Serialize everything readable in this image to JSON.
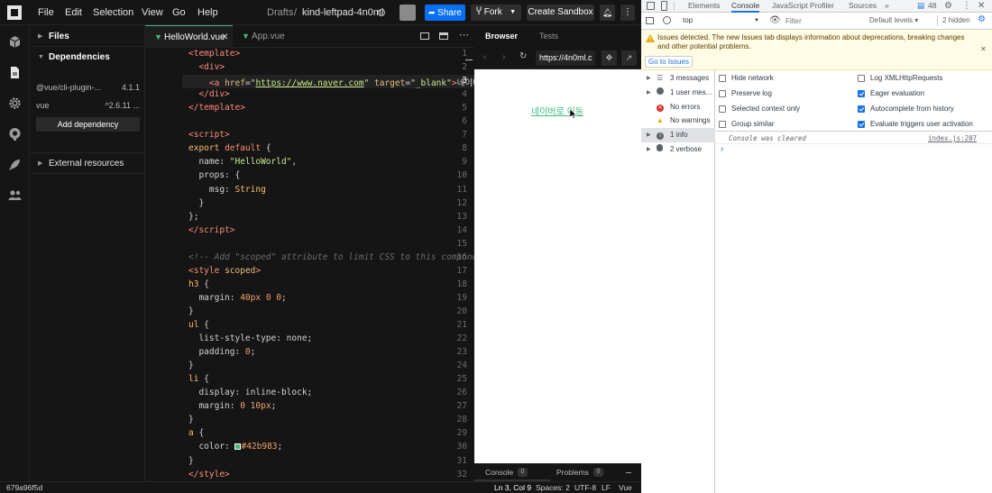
{
  "colors": {
    "accent": "#0971f1",
    "vue_green": "#42b983",
    "issue_bg": "#fffbe5"
  },
  "menu": {
    "file": "File",
    "edit": "Edit",
    "selection": "Selection",
    "view": "View",
    "go": "Go",
    "help": "Help"
  },
  "sandbox": {
    "folder": "Drafts",
    "sep": "/",
    "name": "kind-leftpad-4n0ml"
  },
  "buttons": {
    "share": "Share",
    "fork": "Fork",
    "create": "Create Sandbox"
  },
  "sidebar": {
    "files": "Files",
    "dependencies": "Dependencies",
    "deps": [
      {
        "name": "@vue/cli-plugin-...",
        "version": "4.1.1"
      },
      {
        "name": "vue",
        "version": "^2.6.11 ..."
      }
    ],
    "add_dependency": "Add dependency",
    "external": "External resources"
  },
  "editor": {
    "tabs": [
      {
        "label": "HelloWorld.vue",
        "active": true
      },
      {
        "label": "App.vue",
        "active": false
      }
    ],
    "current_line": 3
  },
  "preview": {
    "tab_browser": "Browser",
    "tab_tests": "Tests",
    "url": "https://4n0ml.c",
    "link_text": "네이버로 이동",
    "console_tab": "Console",
    "console_count": "0",
    "problems_tab": "Problems",
    "problems_count": "0"
  },
  "status": {
    "id": "679a96f5d",
    "position": "Ln 3, Col 9",
    "spaces": "Spaces: 2",
    "encoding": "UTF-8",
    "eol": "LF",
    "language": "Vue"
  },
  "devtools": {
    "tabs": [
      "Elements",
      "Console",
      "JavaScript Profiler",
      "Sources"
    ],
    "active_tab": "Console",
    "more": "»",
    "badge_count": "48",
    "context": "top",
    "filter_placeholder": "Filter",
    "levels": "Default levels ▾",
    "hidden": "2 hidden",
    "issue_text": "Issues detected. The new Issues tab displays information about deprecations, breaking changes and other potential problems.",
    "go_to_issues": "Go to Issues",
    "categories": [
      {
        "label": "3 messages",
        "icon": "list-icon",
        "arrow": true
      },
      {
        "label": "1 user mes...",
        "icon": "user-icon",
        "arrow": true
      },
      {
        "label": "No errors",
        "icon": "error-icon",
        "arrow": false
      },
      {
        "label": "No warnings",
        "icon": "warning-icon",
        "arrow": false
      },
      {
        "label": "1 info",
        "icon": "info-icon",
        "arrow": true
      },
      {
        "label": "2 verbose",
        "icon": "bug-icon",
        "arrow": true
      }
    ],
    "options_left": [
      {
        "label": "Hide network",
        "checked": false
      },
      {
        "label": "Preserve log",
        "checked": false
      },
      {
        "label": "Selected context only",
        "checked": false
      },
      {
        "label": "Group similar",
        "checked": false
      }
    ],
    "options_right": [
      {
        "label": "Log XMLHttpRequests",
        "checked": false
      },
      {
        "label": "Eager evaluation",
        "checked": true
      },
      {
        "label": "Autocomplete from history",
        "checked": true
      },
      {
        "label": "Evaluate triggers user activation",
        "checked": true
      }
    ],
    "console_cleared": "Console was cleared",
    "source": "index.js:207",
    "prompt": "›"
  }
}
